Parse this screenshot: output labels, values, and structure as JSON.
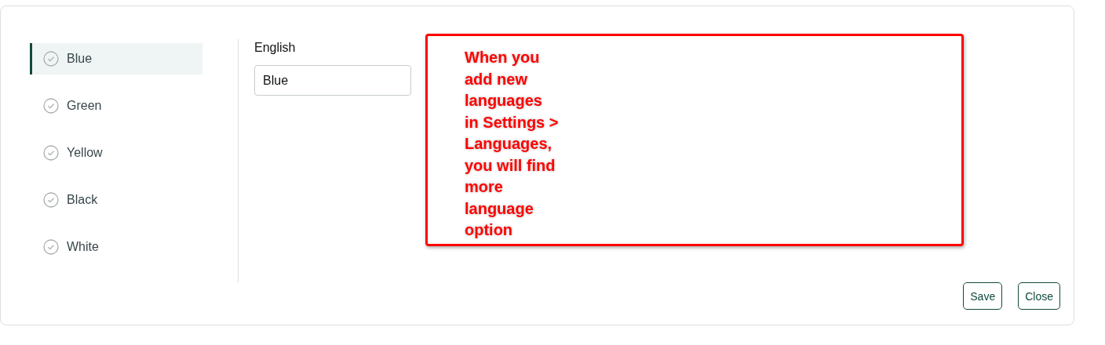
{
  "sidebar": {
    "items": [
      {
        "label": "Blue",
        "selected": true
      },
      {
        "label": "Green",
        "selected": false
      },
      {
        "label": "Yellow",
        "selected": false
      },
      {
        "label": "Black",
        "selected": false
      },
      {
        "label": "White",
        "selected": false
      }
    ]
  },
  "editor": {
    "label": "English",
    "value": "Blue"
  },
  "annotation": {
    "lines": [
      "When you",
      "add new",
      "languages",
      "in Settings >",
      "Languages,",
      "you will find",
      "more",
      "language",
      "option"
    ]
  },
  "buttons": [
    "Save",
    "Close"
  ]
}
